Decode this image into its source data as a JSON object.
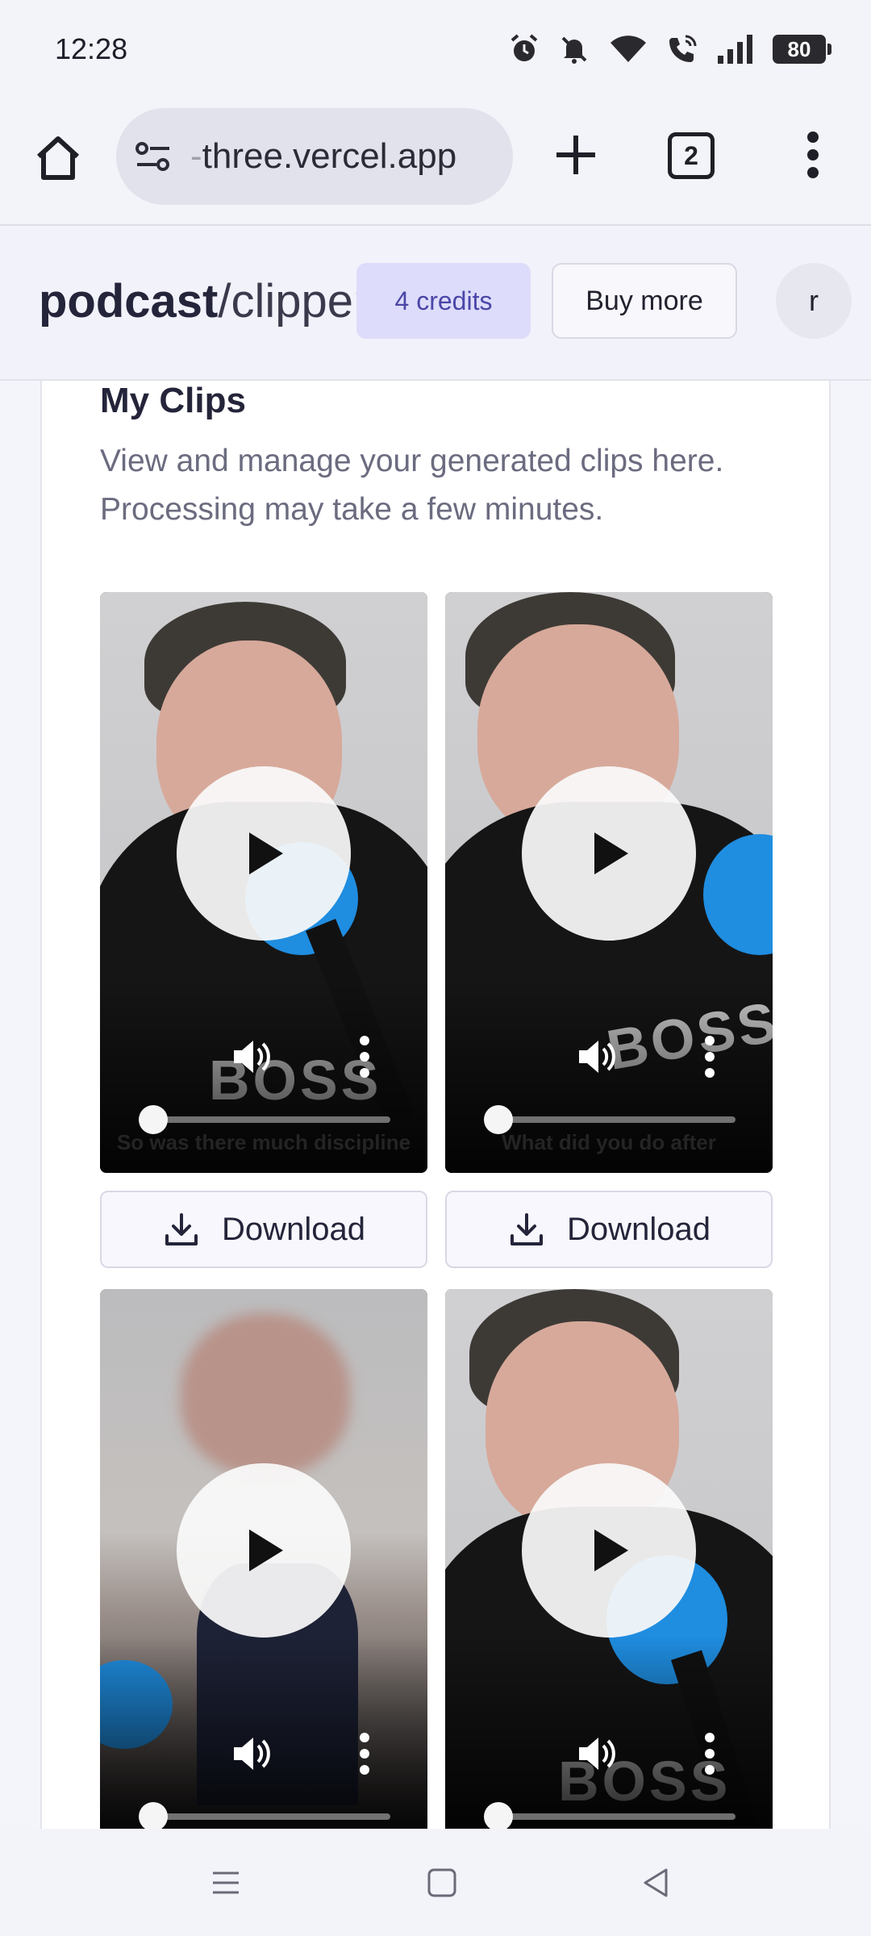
{
  "status_bar": {
    "time": "12:28",
    "battery": "80",
    "icons": [
      "alarm-icon",
      "mute-icon",
      "wifi-icon",
      "wifi-call-icon",
      "signal-icon",
      "battery-icon"
    ]
  },
  "browser": {
    "url_fade": "-",
    "url": "three.vercel.app",
    "tab_count": "2"
  },
  "header": {
    "brand_bold": "podcast",
    "brand_light": "/clipper",
    "credits": "4 credits",
    "buy_more": "Buy more",
    "avatar": "r"
  },
  "main": {
    "title": "My Clips",
    "description": "View and manage your generated clips here. Processing may take a few minutes.",
    "clips": [
      {
        "caption": "So was there much discipline",
        "download_label": "Download",
        "progress": 0
      },
      {
        "caption": "What did you do after",
        "download_label": "Download",
        "progress": 0
      },
      {
        "caption": "",
        "download_label": "Download",
        "progress": 0
      },
      {
        "caption": "",
        "download_label": "Download",
        "progress": 0
      }
    ]
  },
  "colors": {
    "accent": "#dddcfa",
    "accent_text": "#4a46a8",
    "mic_blue": "#1f8de0"
  }
}
